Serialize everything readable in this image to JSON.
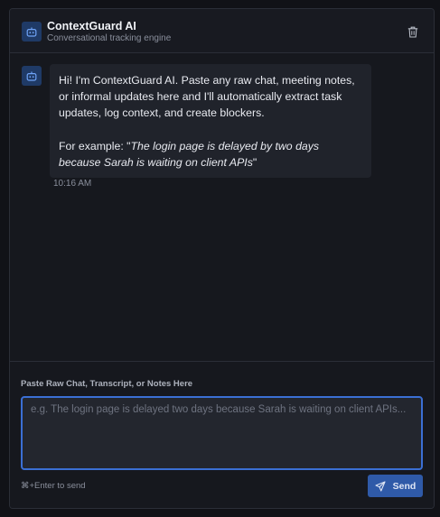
{
  "header": {
    "title": "ContextGuard AI",
    "subtitle": "Conversational tracking engine",
    "bot_icon": "bot-icon",
    "clear_icon": "trash-icon"
  },
  "messages": [
    {
      "sender_icon": "bot-icon",
      "intro": "Hi! I'm ContextGuard AI. Paste any raw chat, meeting notes, or informal updates here and I'll automatically extract task updates, log context, and create blockers.",
      "example_prefix": "For example: \"",
      "example_quote": "The login page is delayed by two days because Sarah is waiting on client APIs",
      "example_suffix": "\"",
      "time": "10:16 AM"
    }
  ],
  "composer": {
    "label": "Paste Raw Chat, Transcript, or Notes Here",
    "value": "",
    "placeholder": "e.g. The login page is delayed two days because Sarah is waiting on client APIs...",
    "hint": "⌘+Enter to send",
    "send_label": "Send",
    "send_icon": "paper-plane-icon"
  },
  "colors": {
    "accent": "#3b6fd4",
    "send_button": "#2f5aa8",
    "background": "#16181e",
    "bubble": "#20232b"
  }
}
